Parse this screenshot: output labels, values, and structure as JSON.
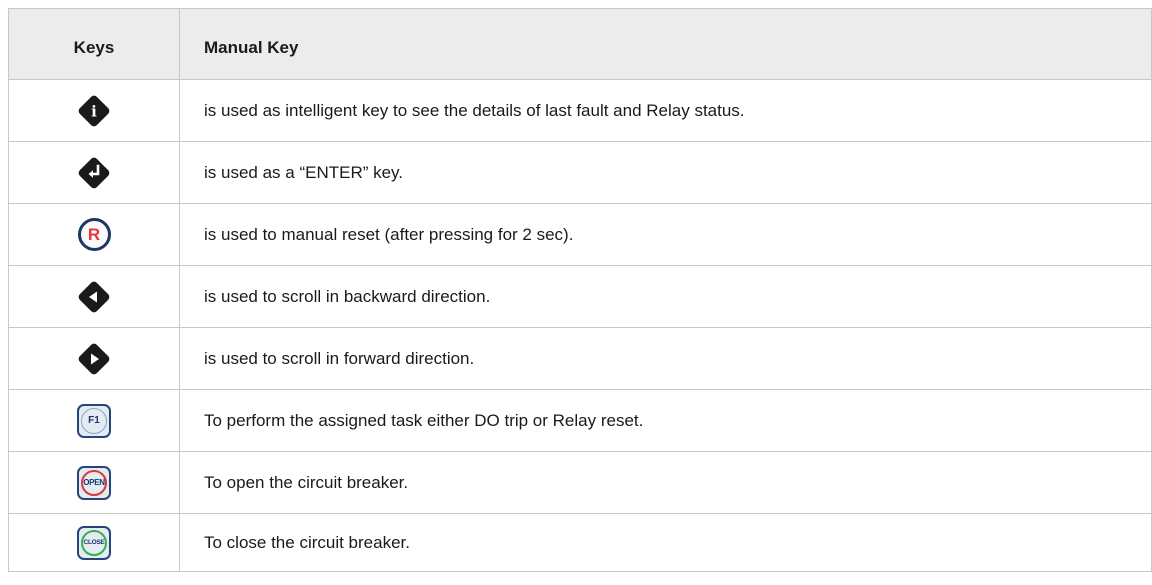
{
  "header": {
    "keys_label": "Keys",
    "manual_key_label": "Manual Key"
  },
  "colors": {
    "header_bg": "#ececec",
    "key_dark": "#1a1a1a",
    "r_key_ring": "#1f3568",
    "r_key_letter": "#e8343a",
    "open_ring": "#d93a3a",
    "close_ring": "#32b24b",
    "soft_key_bg": "#e3ecf3"
  },
  "rows": [
    {
      "icon": "info-key-icon",
      "glyph": "i",
      "description": "is used as intelligent key to see the details of last fault and Relay status."
    },
    {
      "icon": "enter-key-icon",
      "glyph": "",
      "description": "is used as a “ENTER” key."
    },
    {
      "icon": "reset-key-icon",
      "glyph": "R",
      "description": "is used to manual reset (after pressing for 2 sec)."
    },
    {
      "icon": "left-arrow-key-icon",
      "glyph": "",
      "description": "is used to scroll in backward direction."
    },
    {
      "icon": "right-arrow-key-icon",
      "glyph": "",
      "description": "is used to scroll in forward direction."
    },
    {
      "icon": "f1-key-icon",
      "glyph": "F1",
      "description": "To perform the assigned task either DO trip or Relay reset."
    },
    {
      "icon": "open-key-icon",
      "glyph": "OPEN",
      "description": "To open the circuit breaker."
    },
    {
      "icon": "close-key-icon",
      "glyph": "CLOSE",
      "description": "To close the circuit breaker."
    }
  ]
}
